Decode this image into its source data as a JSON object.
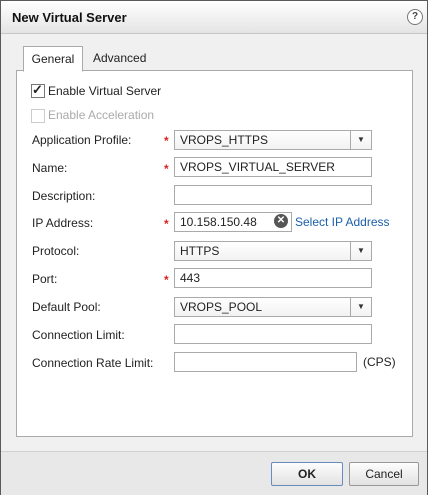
{
  "dialog": {
    "title": "New Virtual Server",
    "help_icon": "?"
  },
  "tabs": [
    {
      "label": "General"
    },
    {
      "label": "Advanced"
    }
  ],
  "form": {
    "enable_virtual_server": {
      "label": "Enable Virtual Server",
      "checked": true
    },
    "enable_acceleration": {
      "label": "Enable Acceleration",
      "checked": false,
      "disabled": true
    },
    "application_profile": {
      "label": "Application Profile:",
      "value": "VROPS_HTTPS"
    },
    "name": {
      "label": "Name:",
      "value": "VROPS_VIRTUAL_SERVER"
    },
    "description": {
      "label": "Description:",
      "value": ""
    },
    "ip_address": {
      "label": "IP Address:",
      "value": "10.158.150.48",
      "link": "Select IP Address"
    },
    "protocol": {
      "label": "Protocol:",
      "value": "HTTPS"
    },
    "port": {
      "label": "Port:",
      "value": "443"
    },
    "default_pool": {
      "label": "Default Pool:",
      "value": "VROPS_POOL"
    },
    "connection_limit": {
      "label": "Connection Limit:",
      "value": ""
    },
    "connection_rate_limit": {
      "label": "Connection Rate Limit:",
      "value": "",
      "unit": "(CPS)"
    },
    "required_mark": "*"
  },
  "buttons": {
    "ok": "OK",
    "cancel": "Cancel"
  },
  "icons": {
    "dropdown": "▼",
    "clear": "✕"
  }
}
